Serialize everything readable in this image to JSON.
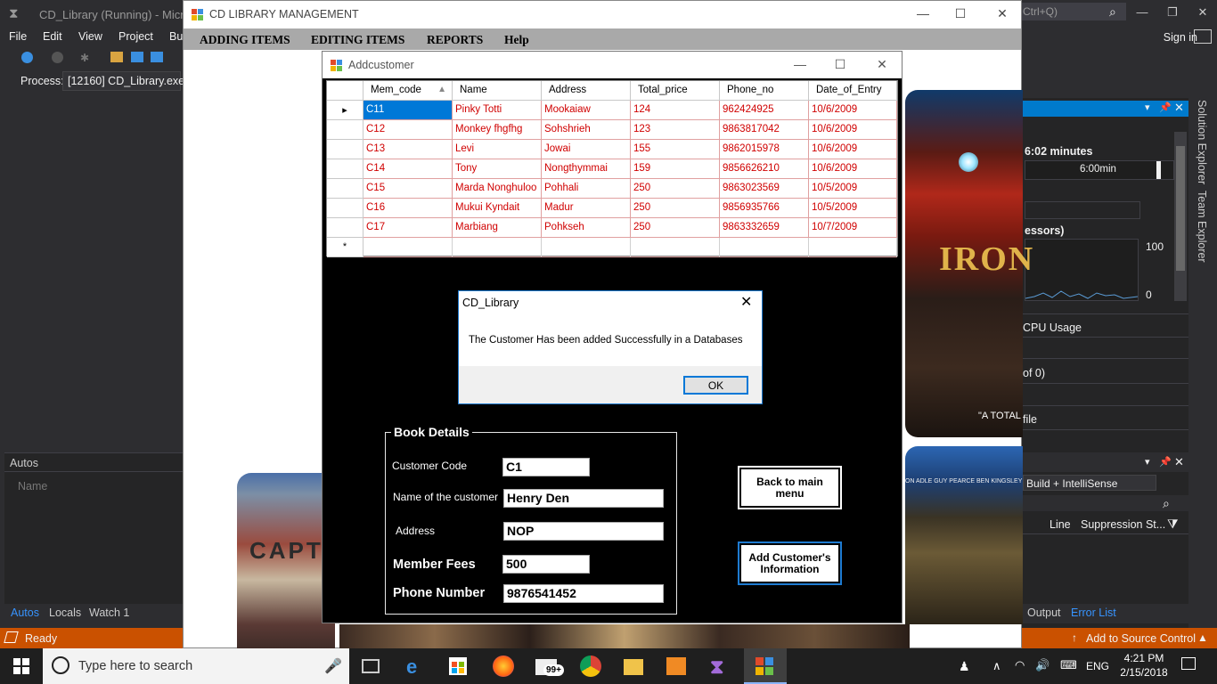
{
  "vs": {
    "title": "CD_Library (Running) - Micros",
    "quicklaunch": "Ctrl+Q)",
    "menu": [
      "File",
      "Edit",
      "View",
      "Project",
      "Bu"
    ],
    "signin": "Sign in",
    "process_label": "Process:",
    "process_value": "[12160] CD_Library.exe",
    "autos_title": "Autos",
    "autos_col": "Name",
    "bottom_tabs": [
      "Autos",
      "Locals",
      "Watch 1"
    ],
    "status_ready": "Ready",
    "status_right": "Add to Source Control",
    "right_tabs": [
      "Solution Explorer",
      "Team Explorer"
    ],
    "perf_time": "6:02 minutes",
    "timeline_label": "6:00min",
    "processors_label": "essors)",
    "graph_max": "100",
    "graph_min": "0",
    "cpu_usage": "CPU Usage",
    "of_zero": "of 0)",
    "file_item": "file",
    "build_filter": "Build + IntelliSense",
    "err_col_line": "Line",
    "err_col_suppression": "Suppression St...",
    "err_tabs": [
      "Output",
      "Error List"
    ]
  },
  "main": {
    "title": "CD LIBRARY MANAGEMENT",
    "menu": [
      "ADDING ITEMS",
      "EDITING ITEMS",
      "REPORTS",
      "Help"
    ],
    "art": {
      "ironman_title": "IRON",
      "ironman_tagline": "\"A TOTAL",
      "cap_title": "CAPTA",
      "credits": "ON  ADLE   GUY PEARCE   BEN KINGSLEY"
    }
  },
  "addcustomer": {
    "title": "Addcustomer",
    "columns": [
      "Mem_code",
      "Name",
      "Address",
      "Total_price",
      "Phone_no",
      "Date_of_Entry"
    ],
    "rows": [
      [
        "C11",
        "Pinky Totti",
        "Mookaiaw",
        "124",
        "962424925",
        "10/6/2009"
      ],
      [
        "C12",
        "Monkey fhgfhg",
        "Sohshrieh",
        "123",
        "9863817042",
        "10/6/2009"
      ],
      [
        "C13",
        "Levi",
        "Jowai",
        "155",
        "9862015978",
        "10/6/2009"
      ],
      [
        "C14",
        "Tony",
        "Nongthymmai",
        "159",
        "9856626210",
        "10/6/2009"
      ],
      [
        "C15",
        "Marda Nonghuloo",
        "Pohhali",
        "250",
        "9863023569",
        "10/5/2009"
      ],
      [
        "C16",
        "Mukui Kyndait",
        "Madur",
        "250",
        "9856935766",
        "10/5/2009"
      ],
      [
        "C17",
        "Marbiang",
        "Pohkseh",
        "250",
        "9863332659",
        "10/7/2009"
      ]
    ],
    "group_title": "Book Details",
    "fields": {
      "customer_code_label": "Customer Code",
      "customer_code": "C1",
      "name_label": "Name of the customer",
      "name": "Henry Den",
      "address_label": "Address",
      "address": "NOP",
      "fees_label": "Member Fees",
      "fees": "500",
      "phone_label": "Phone Number",
      "phone": "9876541452"
    },
    "back_button": "Back to main menu",
    "add_button": "Add Customer's Information"
  },
  "dialog": {
    "title": "CD_Library",
    "message": "The Customer Has been added Successfully in a Databases",
    "ok": "OK"
  },
  "taskbar": {
    "search_placeholder": "Type here to search",
    "mail_badge": "99+",
    "lang": "ENG",
    "time": "4:21 PM",
    "date": "2/15/2018"
  },
  "colors": {
    "vs_bg": "#2d2d30",
    "vs_status": "#ca5100",
    "accent": "#0078d7",
    "grid_text": "#d00000"
  }
}
